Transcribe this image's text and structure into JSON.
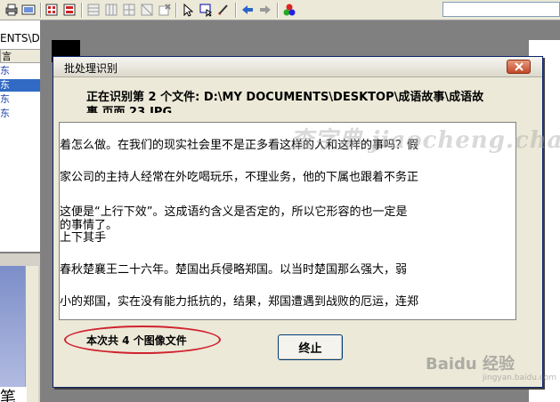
{
  "left_pane": {
    "path_label": "ENTS\\D",
    "list_header": "言",
    "items": [
      "东",
      "东",
      "东",
      "东"
    ],
    "bottom_char": "笔"
  },
  "dialog": {
    "title": "批处理识别",
    "status_text_line1": "正在识别第 2 个文件:  D:\\MY DOCUMENTS\\DESKTOP\\成语故事\\成语故",
    "status_text_line2": "事  页面  23.JPG",
    "text_lines": [
      "着怎么做。在我们的现实社会里不是正多看这样的人和这样的事吗？假",
      "家公司的主持人经常在外吃喝玩乐，不理业务，他的下属也跟着不务正",
      "这便是“上行下效”。这成语约含义是否定的，所以它形容的也一定是",
      "的事情了。",
      "上下其手",
      " 春秋楚襄王二十六年。楚国出兵侵略郑国。以当时楚国那么强大，弱",
      "小的郑国，实在没有能力抵抗的，结果，郑国遭遇到战败的厄运，连郑"
    ],
    "count_label": "本次共 4 个图像文件",
    "stop_button": "终止"
  },
  "watermarks": {
    "top": "查字典 jiaocheng.chazidian.com",
    "bottom": "Baidu 经验",
    "bottom_sub": "jingyan.baidu.com"
  },
  "icons": {
    "toolbar": [
      "print-icon",
      "scan-icon",
      "page-layout-icon",
      "recognize-icon",
      "grid-icon-1",
      "grid-icon-2",
      "grid-icon-3",
      "grid-icon-4",
      "erase-icon",
      "pointer-icon",
      "select-box-icon",
      "pen-icon",
      "arrow-left-icon",
      "arrow-right-icon",
      "color-icon"
    ]
  }
}
